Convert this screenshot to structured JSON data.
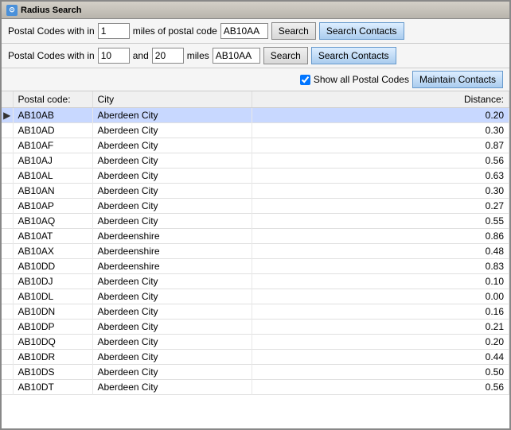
{
  "window": {
    "title": "Radius Search"
  },
  "row1": {
    "label": "Postal Codes with in",
    "input1_value": "1",
    "middle_text": "miles of postal code",
    "postal_code_value": "AB10AA",
    "search_label": "Search",
    "search_contacts_label": "Search Contacts"
  },
  "row2": {
    "label": "Postal Codes with in",
    "input1_value": "10",
    "and_text": "and",
    "input2_value": "20",
    "miles_text": "miles",
    "postal_code_value": "AB10AA",
    "search_label": "Search",
    "search_contacts_label": "Search Contacts"
  },
  "checkbox_row": {
    "label": "Show all Postal Codes",
    "maintain_contacts_label": "Maintain Contacts"
  },
  "table": {
    "headers": {
      "postal_code": "Postal code:",
      "city": "City",
      "distance": "Distance:"
    },
    "rows": [
      {
        "indicator": "▶",
        "postal_code": "AB10AB",
        "city": "Aberdeen City",
        "distance": "0.20"
      },
      {
        "indicator": "",
        "postal_code": "AB10AD",
        "city": "Aberdeen City",
        "distance": "0.30"
      },
      {
        "indicator": "",
        "postal_code": "AB10AF",
        "city": "Aberdeen City",
        "distance": "0.87"
      },
      {
        "indicator": "",
        "postal_code": "AB10AJ",
        "city": "Aberdeen City",
        "distance": "0.56"
      },
      {
        "indicator": "",
        "postal_code": "AB10AL",
        "city": "Aberdeen City",
        "distance": "0.63"
      },
      {
        "indicator": "",
        "postal_code": "AB10AN",
        "city": "Aberdeen City",
        "distance": "0.30"
      },
      {
        "indicator": "",
        "postal_code": "AB10AP",
        "city": "Aberdeen City",
        "distance": "0.27"
      },
      {
        "indicator": "",
        "postal_code": "AB10AQ",
        "city": "Aberdeen City",
        "distance": "0.55"
      },
      {
        "indicator": "",
        "postal_code": "AB10AT",
        "city": "Aberdeenshire",
        "distance": "0.86"
      },
      {
        "indicator": "",
        "postal_code": "AB10AX",
        "city": "Aberdeenshire",
        "distance": "0.48"
      },
      {
        "indicator": "",
        "postal_code": "AB10DD",
        "city": "Aberdeenshire",
        "distance": "0.83"
      },
      {
        "indicator": "",
        "postal_code": "AB10DJ",
        "city": "Aberdeen City",
        "distance": "0.10"
      },
      {
        "indicator": "",
        "postal_code": "AB10DL",
        "city": "Aberdeen City",
        "distance": "0.00"
      },
      {
        "indicator": "",
        "postal_code": "AB10DN",
        "city": "Aberdeen City",
        "distance": "0.16"
      },
      {
        "indicator": "",
        "postal_code": "AB10DP",
        "city": "Aberdeen City",
        "distance": "0.21"
      },
      {
        "indicator": "",
        "postal_code": "AB10DQ",
        "city": "Aberdeen City",
        "distance": "0.20"
      },
      {
        "indicator": "",
        "postal_code": "AB10DR",
        "city": "Aberdeen City",
        "distance": "0.44"
      },
      {
        "indicator": "",
        "postal_code": "AB10DS",
        "city": "Aberdeen City",
        "distance": "0.50"
      },
      {
        "indicator": "",
        "postal_code": "AB10DT",
        "city": "Aberdeen City",
        "distance": "0.56"
      }
    ]
  }
}
